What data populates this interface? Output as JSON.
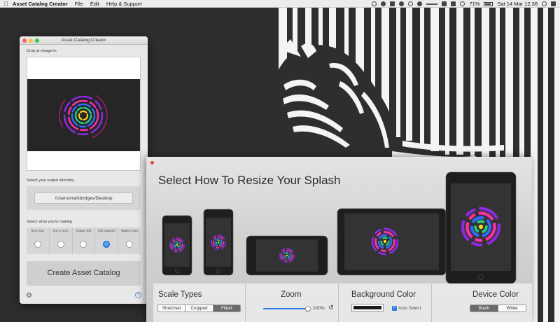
{
  "menubar": {
    "app_name": "Asset Catalog Creator",
    "items": [
      "File",
      "Edit",
      "Help & Support"
    ],
    "battery": "71%",
    "clock": "Sat 14 Mar  12:38"
  },
  "window": {
    "title": "Asset Catalog Creator",
    "drop_label": "Drop an image in",
    "output_label": "Select your output directory",
    "output_path": "/Users/markbridges/Desktop",
    "making_label": "Select what you're making",
    "types": [
      {
        "label": "iOS Icon",
        "selected": false
      },
      {
        "label": "OS X Icon",
        "selected": false
      },
      {
        "label": "Image Set",
        "selected": false
      },
      {
        "label": "iOS Launch",
        "selected": true
      },
      {
        "label": "Watch Icon",
        "selected": false
      }
    ],
    "create_label": "Create Asset Catalog",
    "help_label": "?"
  },
  "splash": {
    "title": "Select How To Resize Your Splash",
    "scale": {
      "heading": "Scale Types",
      "options": [
        "Stretched",
        "Cropped",
        "Fitted"
      ],
      "selected": "Fitted"
    },
    "zoom": {
      "heading": "Zoom",
      "value_label": "200%",
      "level_fraction": 1.0
    },
    "background": {
      "heading": "Background Color",
      "color": "#1a1a1a",
      "auto_select_label": "Auto Select",
      "auto_select_checked": true
    },
    "device_color": {
      "heading": "Device Color",
      "options": [
        "Black",
        "White"
      ],
      "selected": "Black"
    }
  },
  "colors": {
    "desktop_bg": "#2e2e2e",
    "accent_blue": "#2f7ae5",
    "close_red": "#e0443e"
  }
}
